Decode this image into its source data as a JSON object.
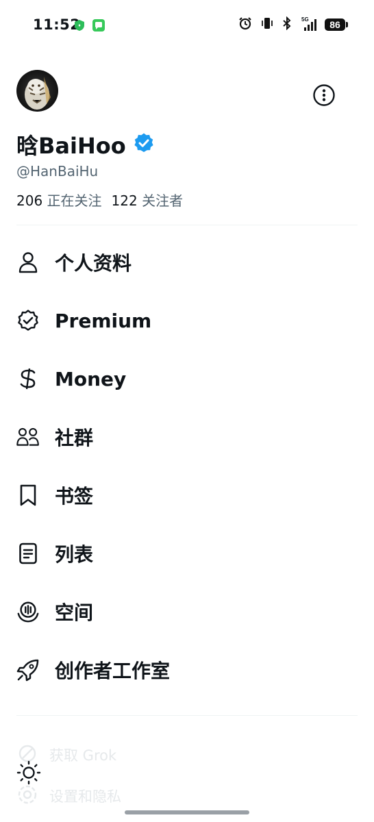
{
  "status_bar": {
    "time": "11:52",
    "left_icons": [
      "shield-icon",
      "message-icon"
    ],
    "right_icons": [
      "alarm-icon",
      "vibrate-icon",
      "bluetooth-icon",
      "signal-5g-icon"
    ],
    "signal_label": "5G",
    "battery": "86"
  },
  "profile": {
    "display_name": "晗BaiHoo",
    "verified": true,
    "handle": "@HanBaiHu",
    "following_count": "206",
    "following_label": "正在关注",
    "followers_count": "122",
    "followers_label": "关注者"
  },
  "menu": {
    "items": [
      {
        "label": "个人资料",
        "icon": "person-icon"
      },
      {
        "label": "Premium",
        "icon": "verified-badge-icon"
      },
      {
        "label": "Money",
        "icon": "dollar-icon"
      },
      {
        "label": "社群",
        "icon": "communities-icon"
      },
      {
        "label": "书签",
        "icon": "bookmark-icon"
      },
      {
        "label": "列表",
        "icon": "list-icon"
      },
      {
        "label": "空间",
        "icon": "spaces-icon"
      },
      {
        "label": "创作者工作室",
        "icon": "rocket-icon"
      }
    ]
  },
  "bottom": {
    "grok_label": "获取 Grok",
    "settings_label": "设置和隐私",
    "theme_icon": "sun-icon"
  },
  "colors": {
    "text": "#0f1419",
    "secondary": "#536471",
    "verified": "#1d9bf0",
    "divider": "#eff3f4",
    "faded": "#e6e9eb"
  }
}
